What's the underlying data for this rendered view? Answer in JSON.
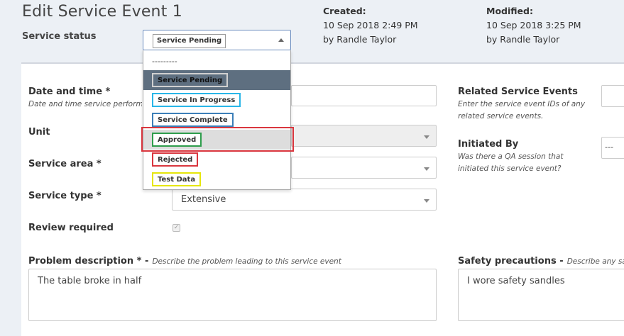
{
  "header": {
    "title": "Edit Service Event 1",
    "service_status_label": "Service status",
    "created_label": "Created:",
    "created_date": "10 Sep 2018 2:49 PM",
    "created_by": "by Randle Taylor",
    "modified_label": "Modified:",
    "modified_date": "10 Sep 2018 3:25 PM",
    "modified_by": "by Randle Taylor"
  },
  "status_select": {
    "selected": "Service Pending",
    "options": [
      {
        "label": "---------"
      },
      {
        "label": "Service Pending",
        "color": "#5e6f80"
      },
      {
        "label": "Service In Progress",
        "color": "#29b6e8"
      },
      {
        "label": "Service Complete",
        "color": "#3c7fb8"
      },
      {
        "label": "Approved",
        "color": "#2e9d4c"
      },
      {
        "label": "Rejected",
        "color": "#d9363e"
      },
      {
        "label": "Test Data",
        "color": "#e6e60a"
      }
    ],
    "hovered": "Approved"
  },
  "form": {
    "date_time_label": "Date and time *",
    "date_time_help": "Date and time service performed",
    "unit_label": "Unit",
    "service_area_label": "Service area *",
    "service_type_label": "Service type *",
    "service_type_value": "Extensive",
    "review_required_label": "Review required",
    "problem_label": "Problem description * -",
    "problem_help": "Describe the problem leading to this service event",
    "problem_value": "The table broke in half",
    "related_label": "Related Service Events",
    "related_help": "Enter the service event IDs of any related service events.",
    "initiated_label": "Initiated By",
    "initiated_help": "Was there a QA session that initiated this service event?",
    "initiated_value": "---",
    "safety_label": "Safety precautions -",
    "safety_help": "Describe any safety pr",
    "safety_value": "I wore safety sandles"
  },
  "colors": {
    "background": "#ecf0f5",
    "selected_option": "#5e6f80",
    "hover_outline": "#d9363e"
  }
}
